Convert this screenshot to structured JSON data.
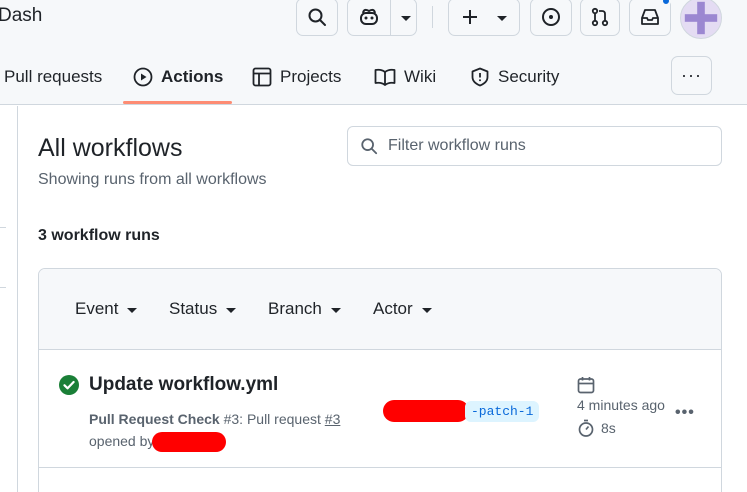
{
  "header": {
    "repo_name": "Dash",
    "tabs": [
      {
        "label": "Pull requests",
        "icon": "pull-request-icon",
        "selected": false
      },
      {
        "label": "Actions",
        "icon": "play-icon",
        "selected": true
      },
      {
        "label": "Projects",
        "icon": "table-icon",
        "selected": false
      },
      {
        "label": "Wiki",
        "icon": "book-icon",
        "selected": false
      },
      {
        "label": "Security",
        "icon": "shield-icon",
        "selected": false
      }
    ],
    "more_label": "···"
  },
  "main": {
    "title": "All workflows",
    "subtitle": "Showing runs from all workflows",
    "filter_placeholder": "Filter workflow runs",
    "runs_count": "3 workflow runs",
    "filters": [
      {
        "label": "Event"
      },
      {
        "label": "Status"
      },
      {
        "label": "Branch"
      },
      {
        "label": "Actor"
      }
    ],
    "runs": [
      {
        "status": "success",
        "title": "Update workflow.yml",
        "workflow": "Pull Request Check",
        "run_number": "#3",
        "meta_text": ": Pull request ",
        "pr_link": "#3",
        "opened_by": "opened by",
        "branch_suffix": "-patch-1",
        "time_ago": "4 minutes ago",
        "duration": "8s",
        "more": "•••"
      }
    ]
  },
  "colors": {
    "accent_underline": "#fd8c73",
    "success": "#1a7f37",
    "link_blue": "#0969da",
    "redaction": "#ff0000"
  }
}
